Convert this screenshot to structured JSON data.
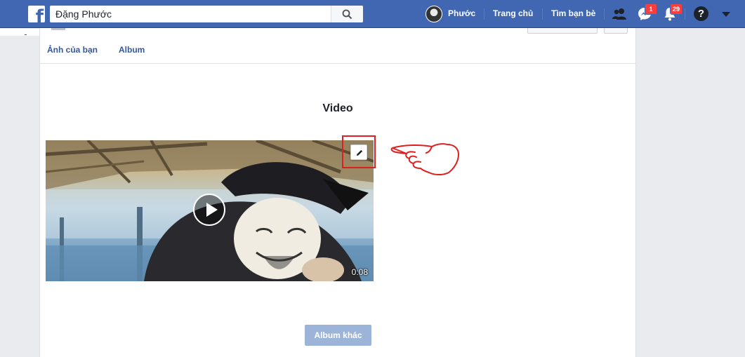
{
  "app": {
    "name": "Facebook"
  },
  "topbar": {
    "logo_glyph": "f",
    "search": {
      "value": "Đặng Phước",
      "icon": "search-icon"
    },
    "profile_name": "Phước",
    "nav": {
      "home": "Trang chủ",
      "find_friends": "Tìm bạn bè"
    },
    "icons": {
      "friends": "friend-requests-icon",
      "messenger": "messenger-icon",
      "notifications": "notifications-icon",
      "help": "help-icon",
      "menu": "caret-down-icon"
    },
    "badges": {
      "messenger": "1",
      "notifications": "29"
    },
    "help_glyph": "?"
  },
  "tabs": [
    {
      "label": "Ảnh của bạn"
    },
    {
      "label": "Album"
    }
  ],
  "section": {
    "title": "Video"
  },
  "video": {
    "duration": "0:08",
    "play_icon": "play-icon",
    "edit_icon": "pencil-icon"
  },
  "annotations": {
    "highlight_color": "#e02020",
    "pointer": "pointing-hand-drawing"
  },
  "buttons": {
    "more_albums": "Album khác"
  },
  "colors": {
    "brand": "#4267b2",
    "link": "#365899",
    "page_bg": "#e9ebee",
    "disabled_button": "#9cb4d8",
    "badge": "#fa3e3e"
  }
}
